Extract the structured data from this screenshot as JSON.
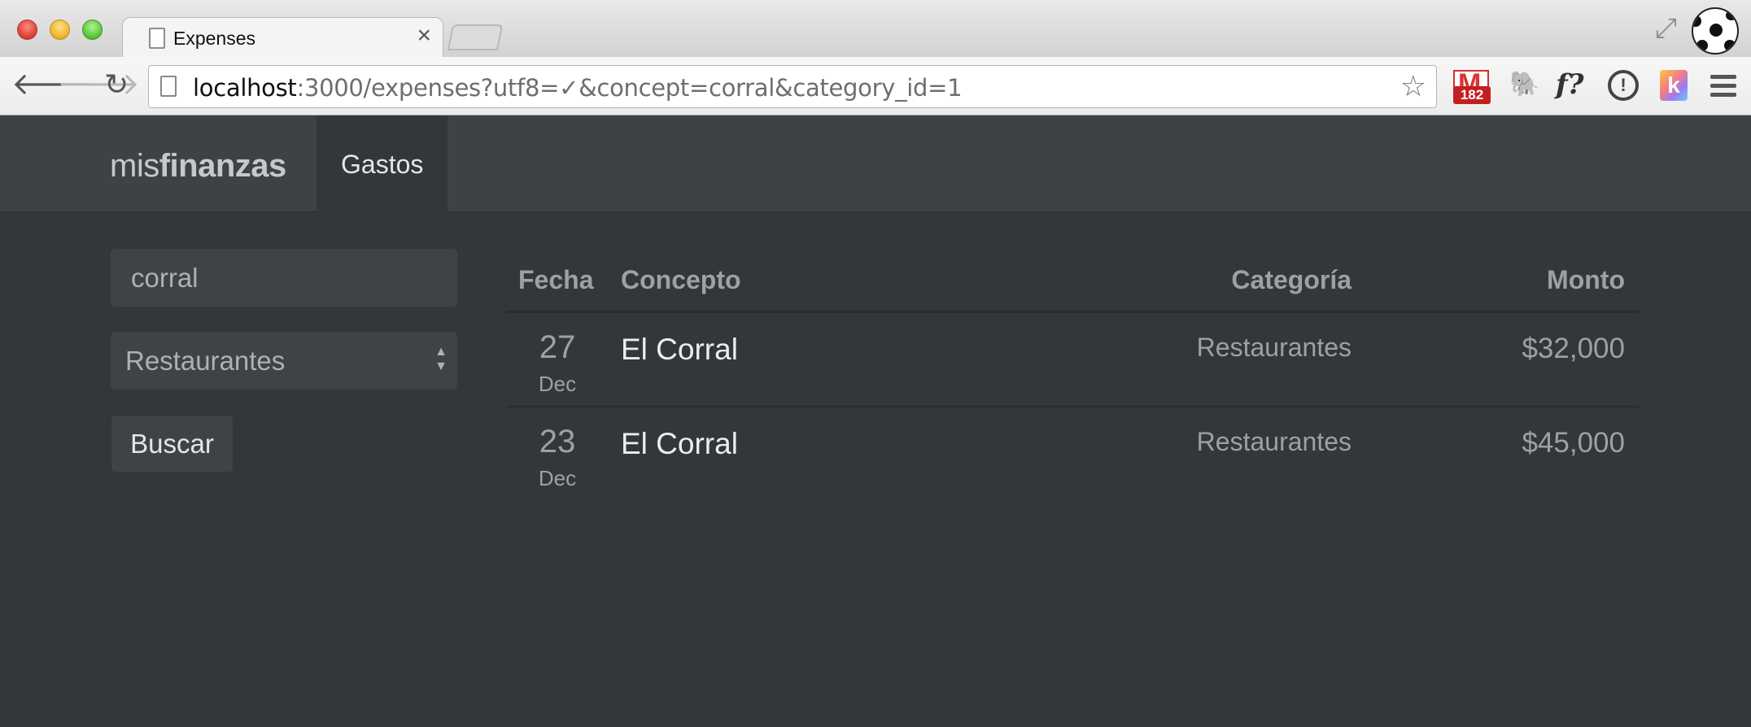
{
  "browser": {
    "tab_title": "Expenses",
    "tab_close": "×",
    "url_host": "localhost",
    "url_rest": ":3000/expenses?utf8=✓&concept=corral&category_id=1",
    "gmail_badge": "182",
    "onepassword_glyph": "!",
    "klout_glyph": "k",
    "fquery_glyph": "f?",
    "icons": [
      "back-icon",
      "forward-icon",
      "reload-icon",
      "page-icon",
      "star-icon",
      "gmail-icon",
      "evernote-icon",
      "fquery-icon",
      "onepassword-icon",
      "klout-icon",
      "menu-icon",
      "fullscreen-icon",
      "profile-avatar"
    ]
  },
  "navbar": {
    "brand_light": "mis",
    "brand_bold": "finanzas",
    "nav_item": "Gastos"
  },
  "filters": {
    "concept_value": "corral",
    "category_value": "Restaurantes",
    "search_label": "Buscar"
  },
  "table": {
    "headers": {
      "fecha": "Fecha",
      "concepto": "Concepto",
      "categoria": "Categoría",
      "monto": "Monto"
    },
    "rows": [
      {
        "day": "27",
        "month": "Dec",
        "concept": "El Corral",
        "category": "Restaurantes",
        "amount": "$32,000"
      },
      {
        "day": "23",
        "month": "Dec",
        "concept": "El Corral",
        "category": "Restaurantes",
        "amount": "$45,000"
      }
    ]
  },
  "colors": {
    "background": "#33373a",
    "navbar": "#3d4245",
    "input_bg": "#3e4346",
    "muted_text": "#9da1a4"
  }
}
